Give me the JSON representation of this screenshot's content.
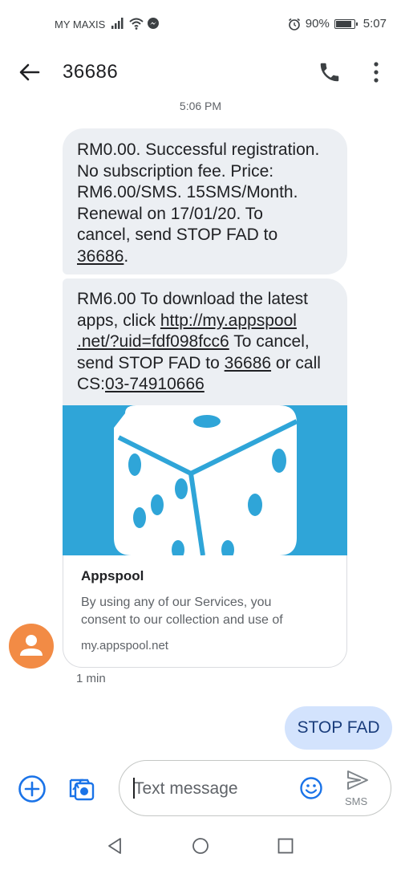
{
  "status_bar": {
    "carrier": "MY MAXIS",
    "battery_percent": "90%",
    "battery_level": 0.9,
    "time": "5:07",
    "icons": [
      "signal-icon",
      "wifi-icon",
      "messenger-icon",
      "alarm-icon",
      "battery-icon"
    ]
  },
  "header": {
    "title": "36686",
    "icons": [
      "back-arrow-icon",
      "phone-icon",
      "more-vert-icon"
    ]
  },
  "conversation": {
    "timestamp": "5:06 PM",
    "message1": {
      "line1": "RM0.00. Successful registration.",
      "line2": "No subscription fee. Price:",
      "line3": "RM6.00/SMS. 15SMS/Month.",
      "line4": "Renewal on 17/01/20. To",
      "line5": "cancel, send STOP FAD to",
      "number": "36686",
      "end": "."
    },
    "message2": {
      "line1": "RM6.00 To download the latest",
      "line2_text": "apps, click ",
      "link_part1": "http://my.appspool",
      "link_part2": ".net/?uid=fdf098fcc6",
      "line3_rest": " To cancel,",
      "line4_text": "send STOP FAD to ",
      "number": "36686",
      "line4_rest": " or call",
      "cs_label": "CS:",
      "cs_number": "03-74910666"
    },
    "link_preview": {
      "image_icon": "dice-icon",
      "title": "Appspool",
      "description_line1": "By using any of our Services, you",
      "description_line2": "consent to our collection and use of",
      "url": "my.appspool.net"
    },
    "message_time": "1 min",
    "outgoing_message": "STOP FAD"
  },
  "composer": {
    "placeholder": "Text message",
    "send_label": "SMS",
    "icons": [
      "add-icon",
      "gallery-icon",
      "emoji-icon",
      "send-icon"
    ]
  },
  "colors": {
    "incoming_bubble": "#eceff3",
    "outgoing_bubble": "#d3e3fd",
    "accent": "#1a73e8",
    "avatar": "#f28b45",
    "preview_image_bg": "#2fa5d8"
  }
}
